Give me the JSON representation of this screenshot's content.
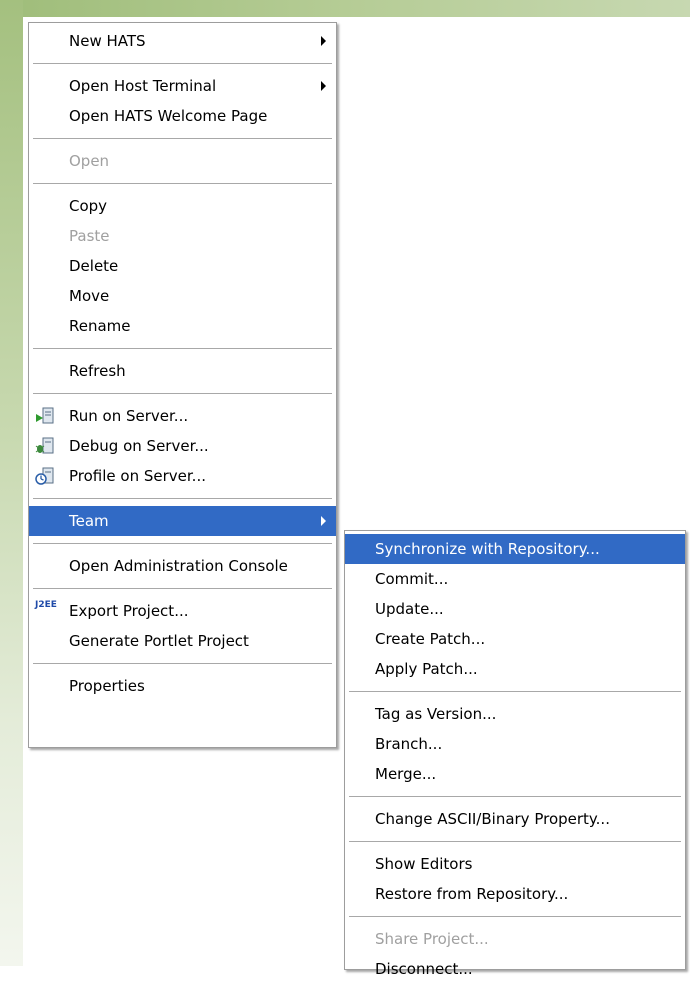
{
  "main_menu": {
    "items": [
      {
        "label": "New HATS"
      },
      {
        "label": "Open Host Terminal"
      },
      {
        "label": "Open HATS Welcome Page"
      },
      {
        "label": "Open"
      },
      {
        "label": "Copy"
      },
      {
        "label": "Paste"
      },
      {
        "label": "Delete"
      },
      {
        "label": "Move"
      },
      {
        "label": "Rename"
      },
      {
        "label": "Refresh"
      },
      {
        "label": "Run on Server..."
      },
      {
        "label": "Debug on Server..."
      },
      {
        "label": "Profile on Server..."
      },
      {
        "label": "Team"
      },
      {
        "label": "Open Administration Console"
      },
      {
        "label": "Export Project..."
      },
      {
        "label": "Generate Portlet Project"
      },
      {
        "label": "Properties"
      }
    ],
    "j2ee_icon_text": "J2EE"
  },
  "team_submenu": {
    "items": [
      {
        "label": "Synchronize with Repository..."
      },
      {
        "label": "Commit..."
      },
      {
        "label": "Update..."
      },
      {
        "label": "Create Patch..."
      },
      {
        "label": "Apply Patch..."
      },
      {
        "label": "Tag as Version..."
      },
      {
        "label": "Branch..."
      },
      {
        "label": "Merge..."
      },
      {
        "label": "Change ASCII/Binary Property..."
      },
      {
        "label": "Show Editors"
      },
      {
        "label": "Restore from Repository..."
      },
      {
        "label": "Share Project..."
      },
      {
        "label": "Disconnect..."
      }
    ]
  },
  "colors": {
    "highlight": "#316ac5",
    "disabled_text": "#a0a0a0",
    "desktop_green": "#a4c07f"
  },
  "icons": [
    "run-server-icon",
    "debug-server-icon",
    "profile-server-icon",
    "j2ee-icon",
    "submenu-arrow-icon"
  ]
}
